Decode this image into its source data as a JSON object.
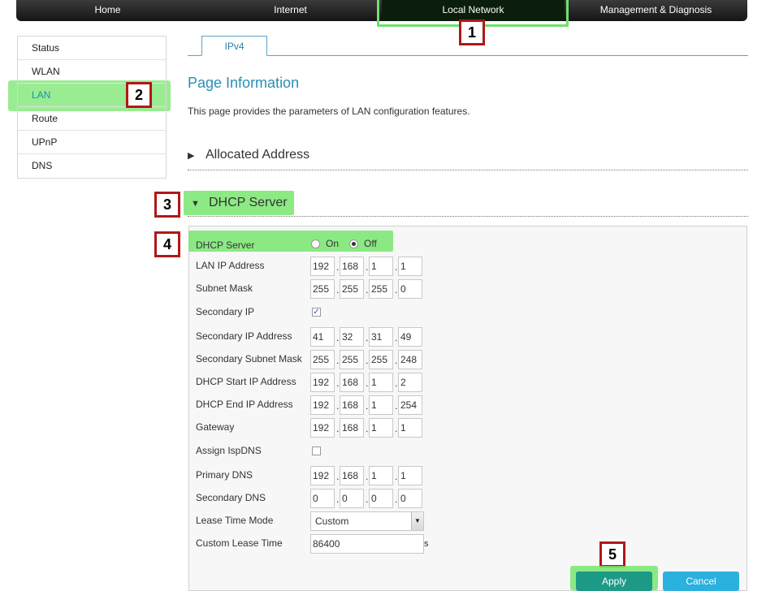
{
  "topnav": {
    "items": [
      {
        "label": "Home"
      },
      {
        "label": "Internet"
      },
      {
        "label": "Local Network"
      },
      {
        "label": "Management & Diagnosis"
      }
    ]
  },
  "sidebar": {
    "items": [
      {
        "label": "Status"
      },
      {
        "label": "WLAN"
      },
      {
        "label": "LAN"
      },
      {
        "label": "Route"
      },
      {
        "label": "UPnP"
      },
      {
        "label": "DNS"
      }
    ]
  },
  "tab": {
    "label": "IPv4"
  },
  "page": {
    "title": "Page Information",
    "description": "This page provides the parameters of LAN configuration features."
  },
  "sections": {
    "allocated": "Allocated Address",
    "dhcp": "DHCP Server"
  },
  "form": {
    "dhcp_server": {
      "label": "DHCP Server",
      "on": "On",
      "off": "Off",
      "selected": "Off"
    },
    "lan_ip": {
      "label": "LAN IP Address",
      "octets": [
        "192",
        "168",
        "1",
        "1"
      ]
    },
    "subnet_mask": {
      "label": "Subnet Mask",
      "octets": [
        "255",
        "255",
        "255",
        "0"
      ]
    },
    "secondary_ip_toggle": {
      "label": "Secondary IP",
      "checked": true
    },
    "secondary_ip": {
      "label": "Secondary IP Address",
      "octets": [
        "41",
        "32",
        "31",
        "49"
      ]
    },
    "secondary_mask": {
      "label": "Secondary Subnet Mask",
      "octets": [
        "255",
        "255",
        "255",
        "248"
      ]
    },
    "dhcp_start": {
      "label": "DHCP Start IP Address",
      "octets": [
        "192",
        "168",
        "1",
        "2"
      ]
    },
    "dhcp_end": {
      "label": "DHCP End IP Address",
      "octets": [
        "192",
        "168",
        "1",
        "254"
      ]
    },
    "gateway": {
      "label": "Gateway",
      "octets": [
        "192",
        "168",
        "1",
        "1"
      ]
    },
    "assign_isp_dns": {
      "label": "Assign IspDNS",
      "checked": false
    },
    "primary_dns": {
      "label": "Primary DNS",
      "octets": [
        "192",
        "168",
        "1",
        "1"
      ]
    },
    "secondary_dns": {
      "label": "Secondary DNS",
      "octets": [
        "0",
        "0",
        "0",
        "0"
      ]
    },
    "lease_mode": {
      "label": "Lease Time Mode",
      "value": "Custom"
    },
    "custom_lease": {
      "label": "Custom Lease Time",
      "value": "86400",
      "unit": "s"
    }
  },
  "buttons": {
    "apply": "Apply",
    "cancel": "Cancel"
  },
  "callouts": [
    "1",
    "2",
    "3",
    "4",
    "5"
  ],
  "colors": {
    "highlight": "#78e66e",
    "callout_border": "#b01818",
    "accent": "#2a8fb5"
  }
}
